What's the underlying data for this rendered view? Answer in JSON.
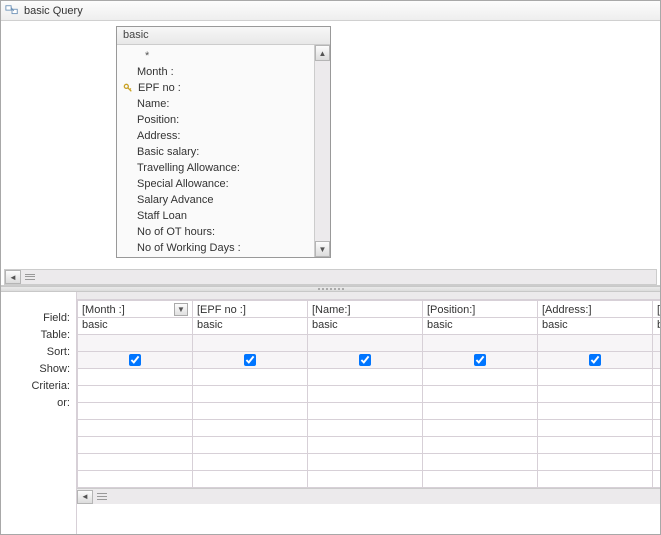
{
  "window": {
    "title": "basic Query"
  },
  "fieldlist": {
    "title": "basic",
    "items": [
      "*",
      "Month :",
      "EPF no :",
      "Name:",
      "Position:",
      "Address:",
      "Basic salary:",
      "Travelling Allowance:",
      "Special Allowance:",
      "Salary Advance",
      "Staff Loan",
      "No of OT hours:",
      "No of Working Days :"
    ],
    "key_index": 2
  },
  "grid": {
    "row_labels": [
      "Field:",
      "Table:",
      "Sort:",
      "Show:",
      "Criteria:",
      "or:"
    ],
    "columns": [
      {
        "field": "[Month :]",
        "table": "basic",
        "show": true,
        "active": true
      },
      {
        "field": "[EPF no :]",
        "table": "basic",
        "show": true,
        "active": false
      },
      {
        "field": "[Name:]",
        "table": "basic",
        "show": true,
        "active": false
      },
      {
        "field": "[Position:]",
        "table": "basic",
        "show": true,
        "active": false
      },
      {
        "field": "[Address:]",
        "table": "basic",
        "show": true,
        "active": false
      },
      {
        "field": "[",
        "table": "b",
        "show": true,
        "active": false
      }
    ]
  }
}
